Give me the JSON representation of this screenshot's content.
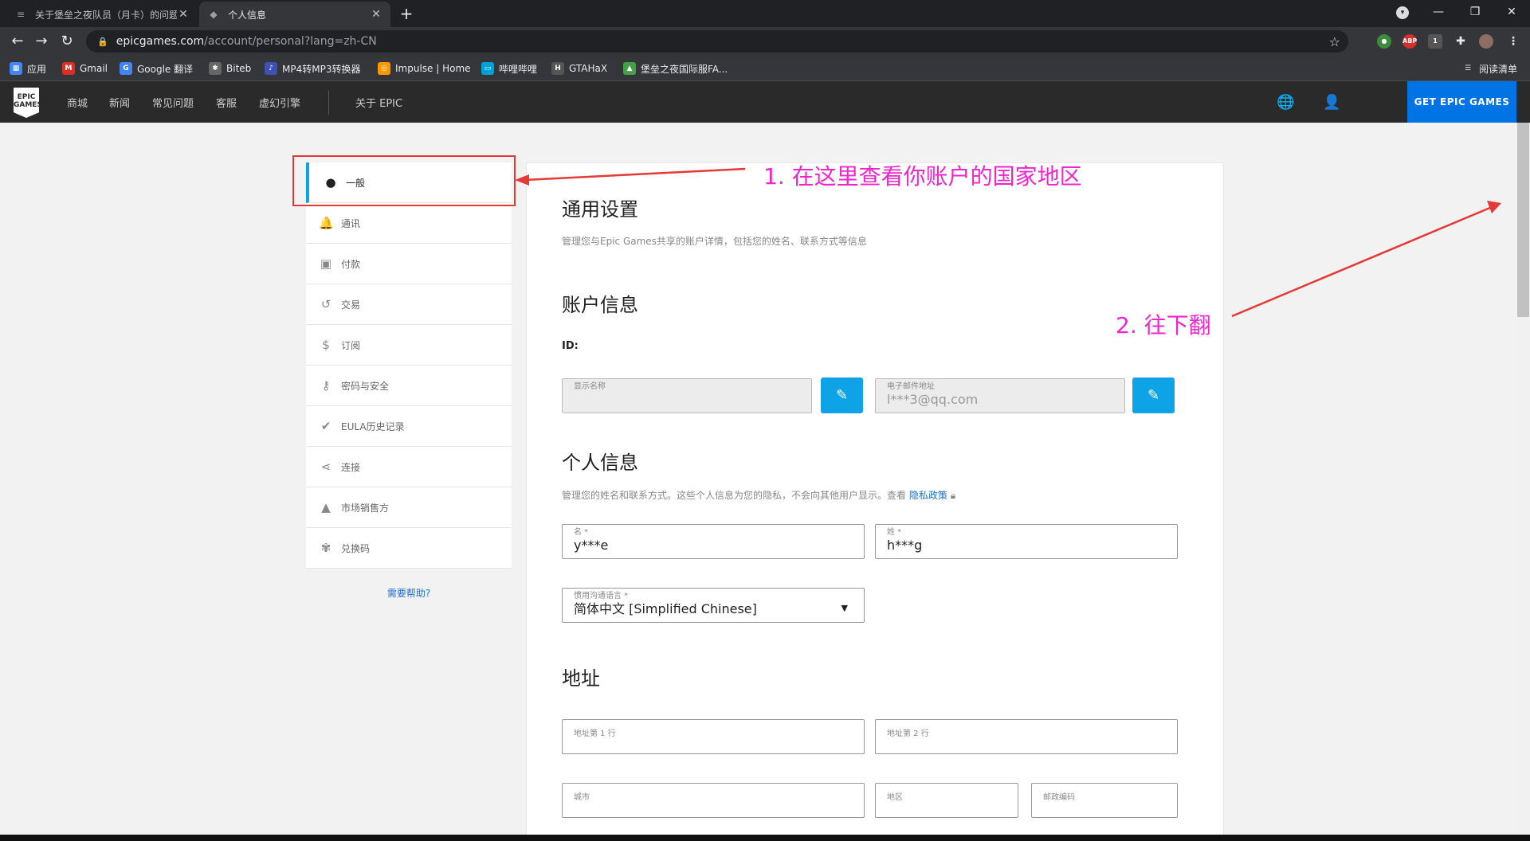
{
  "browser": {
    "tabs": [
      {
        "title": "关于堡垒之夜队员（月卡）的问题",
        "active": false
      },
      {
        "title": "个人信息",
        "active": true
      }
    ],
    "new_tab": "+",
    "url_host": "epicgames.com",
    "url_path": "/account/personal?lang=zh-CN",
    "bookmarks": [
      {
        "label": "应用",
        "icon": "apps-grid-icon"
      },
      {
        "label": "Gmail",
        "icon": "gmail-icon"
      },
      {
        "label": "Google 翻译",
        "icon": "translate-icon"
      },
      {
        "label": "Biteb",
        "icon": "biteb-icon"
      },
      {
        "label": "MP4转MP3转换器",
        "icon": "converter-icon"
      },
      {
        "label": "Impulse | Home",
        "icon": "impulse-icon"
      },
      {
        "label": "哔哩哔哩",
        "icon": "bilibili-icon"
      },
      {
        "label": "GTAHaX",
        "icon": "gtahax-icon"
      },
      {
        "label": "堡垒之夜国际服FA...",
        "icon": "fortnite-icon"
      }
    ],
    "reading_list": "阅读清单",
    "extension_badge": "1"
  },
  "epic_nav": {
    "logo": "EPIC GAMES",
    "links": [
      "商城",
      "新闻",
      "常见问题",
      "客服",
      "虚幻引擎"
    ],
    "about": "关于 EPIC",
    "cta": "GET EPIC GAMES"
  },
  "sidebar": {
    "items": [
      {
        "label": "一般",
        "icon": "person-icon",
        "active": true
      },
      {
        "label": "通讯",
        "icon": "bell-icon",
        "active": false
      },
      {
        "label": "付款",
        "icon": "wallet-icon",
        "active": false
      },
      {
        "label": "交易",
        "icon": "history-icon",
        "active": false
      },
      {
        "label": "订阅",
        "icon": "subscription-icon",
        "active": false
      },
      {
        "label": "密码与安全",
        "icon": "key-icon",
        "active": false
      },
      {
        "label": "EULA历史记录",
        "icon": "clipboard-check-icon",
        "active": false
      },
      {
        "label": "连接",
        "icon": "share-icon",
        "active": false
      },
      {
        "label": "市场销售方",
        "icon": "seller-icon",
        "active": false
      },
      {
        "label": "兑换码",
        "icon": "gift-icon",
        "active": false
      }
    ],
    "help": "需要帮助?"
  },
  "general": {
    "title": "通用设置",
    "subtitle": "管理您与Epic Games共享的账户详情，包括您的姓名、联系方式等信息"
  },
  "account": {
    "title": "账户信息",
    "id_label": "ID:",
    "display_name_label": "显示名称",
    "display_name_value": "",
    "email_label": "电子邮件地址",
    "email_value": "l***3@qq.com"
  },
  "personal": {
    "title": "个人信息",
    "subtitle": "管理您的姓名和联系方式。这些个人信息为您的隐私，不会向其他用户显示。查看",
    "privacy_link": "隐私政策",
    "first_name_label": "名 *",
    "first_name_value": "y***e",
    "last_name_label": "姓 *",
    "last_name_value": "h***g",
    "language_label": "惯用沟通语言 *",
    "language_value": "简体中文 [Simplified Chinese]"
  },
  "address": {
    "title": "地址",
    "line1_placeholder": "地址第 1 行",
    "line2_placeholder": "地址第 2 行",
    "city_placeholder": "城市",
    "region_placeholder": "地区",
    "postal_placeholder": "邮政编码"
  },
  "annotations": {
    "step1": "1. 在这里查看你账户的国家地区",
    "step2": "2. 往下翻",
    "color": "#f026cc",
    "arrow_color": "#e53935"
  }
}
